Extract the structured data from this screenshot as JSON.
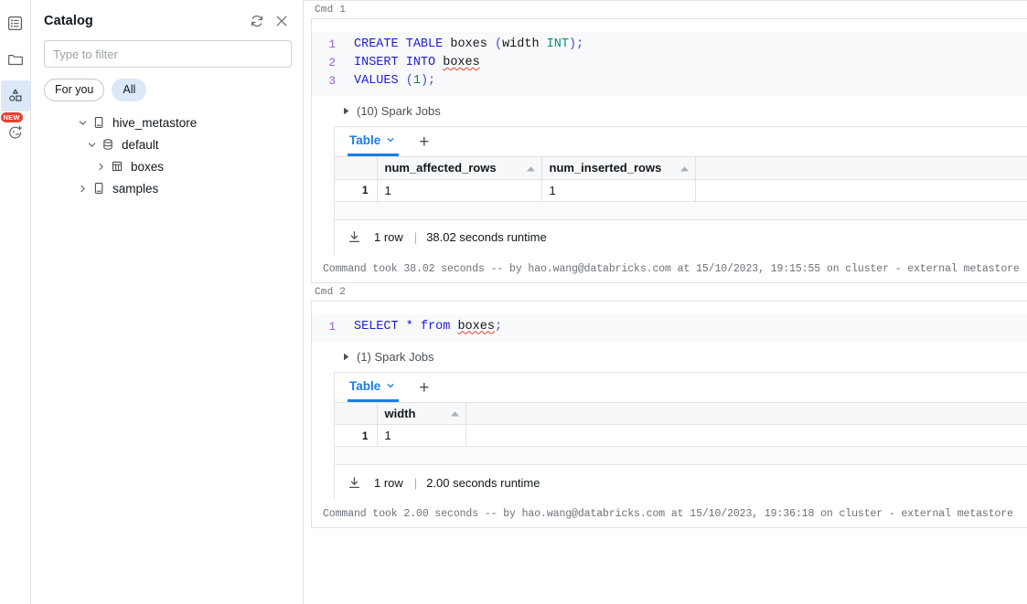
{
  "rail": {
    "items": [
      {
        "name": "workspace-icon",
        "label": "Workspace"
      },
      {
        "name": "folder-icon",
        "label": "Repos"
      },
      {
        "name": "catalog-icon",
        "label": "Catalog",
        "active": true
      },
      {
        "name": "assistant-icon",
        "label": "Assistant",
        "badge": "NEW"
      }
    ]
  },
  "catalog": {
    "title": "Catalog",
    "refresh_icon": "refresh-icon",
    "close_icon": "close-icon",
    "filter": {
      "placeholder": "Type to filter",
      "value": ""
    },
    "pills": [
      {
        "label": "For you",
        "selected": false
      },
      {
        "label": "All",
        "selected": true
      }
    ],
    "tree": [
      {
        "label": "hive_metastore",
        "icon": "catalog-book-icon",
        "expanded": true,
        "level": 1
      },
      {
        "label": "default",
        "icon": "database-icon",
        "expanded": true,
        "level": 2
      },
      {
        "label": "boxes",
        "icon": "table-icon",
        "expanded": false,
        "level": 3
      },
      {
        "label": "samples",
        "icon": "catalog-book-icon",
        "expanded": false,
        "level": 1
      }
    ]
  },
  "notebook": {
    "cells": [
      {
        "label": "Cmd 1",
        "code_lines": [
          {
            "n": "1",
            "tokens": [
              {
                "t": "CREATE",
                "c": "k"
              },
              {
                "t": " ",
                "c": "nm"
              },
              {
                "t": "TABLE",
                "c": "k"
              },
              {
                "t": " ",
                "c": "nm"
              },
              {
                "t": "boxes",
                "c": "nm"
              },
              {
                "t": " ",
                "c": "nm"
              },
              {
                "t": "(",
                "c": "pn"
              },
              {
                "t": "width",
                "c": "nm"
              },
              {
                "t": " ",
                "c": "nm"
              },
              {
                "t": "INT",
                "c": "ty"
              },
              {
                "t": ")",
                "c": "pn"
              },
              {
                "t": ";",
                "c": "pn"
              }
            ]
          },
          {
            "n": "2",
            "tokens": [
              {
                "t": "INSERT",
                "c": "k"
              },
              {
                "t": " ",
                "c": "nm"
              },
              {
                "t": "INTO",
                "c": "k"
              },
              {
                "t": " ",
                "c": "nm"
              },
              {
                "t": "boxes",
                "c": "nm squig"
              }
            ]
          },
          {
            "n": "3",
            "tokens": [
              {
                "t": "VALUES",
                "c": "k"
              },
              {
                "t": " ",
                "c": "nm"
              },
              {
                "t": "(",
                "c": "pn"
              },
              {
                "t": "1",
                "c": "num"
              },
              {
                "t": ")",
                "c": "pn"
              },
              {
                "t": ";",
                "c": "pn"
              }
            ]
          }
        ],
        "spark_jobs": "(10) Spark Jobs",
        "result": {
          "tab_label": "Table",
          "add_label": "+",
          "columns": [
            "num_affected_rows",
            "num_inserted_rows"
          ],
          "rows": [
            {
              "index": "1",
              "cells": [
                "1",
                "1"
              ]
            }
          ],
          "row_count": "1 row",
          "runtime": "38.02 seconds runtime"
        },
        "footer": "Command took 38.02 seconds -- by hao.wang@databricks.com at 15/10/2023, 19:15:55 on cluster - external metastore"
      },
      {
        "label": "Cmd 2",
        "code_lines": [
          {
            "n": "1",
            "tokens": [
              {
                "t": "SELECT",
                "c": "k"
              },
              {
                "t": " ",
                "c": "nm"
              },
              {
                "t": "*",
                "c": "star"
              },
              {
                "t": " ",
                "c": "nm"
              },
              {
                "t": "from",
                "c": "k"
              },
              {
                "t": " ",
                "c": "nm"
              },
              {
                "t": "boxes",
                "c": "nm squig"
              },
              {
                "t": ";",
                "c": "pn"
              }
            ]
          }
        ],
        "spark_jobs": "(1) Spark Jobs",
        "result": {
          "tab_label": "Table",
          "add_label": "+",
          "columns": [
            "width"
          ],
          "rows": [
            {
              "index": "1",
              "cells": [
                "1"
              ]
            }
          ],
          "row_count": "1 row",
          "runtime": "2.00 seconds runtime"
        },
        "footer": "Command took 2.00 seconds -- by hao.wang@databricks.com at 15/10/2023, 19:36:18 on cluster - external metastore"
      }
    ]
  },
  "colors": {
    "accent_blue": "#1b7ce8",
    "keyword_blue": "#2020d8",
    "type_teal": "#0a8a7a",
    "number_green": "#0f8a3c",
    "line_number_purple": "#8f5fd1",
    "badge_red": "#e8412c",
    "pill_selected": "#dce8f7"
  }
}
